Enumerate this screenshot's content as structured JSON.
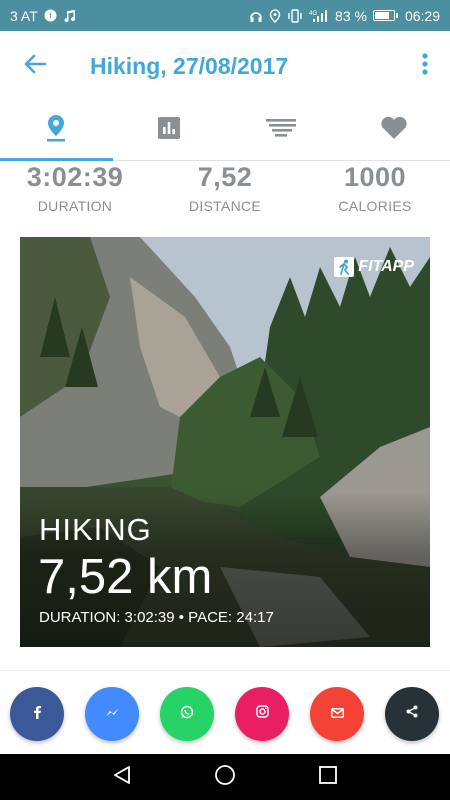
{
  "status_bar": {
    "carrier": "3 AT",
    "battery": "83 %",
    "battery_level": 0.83,
    "time": "06:29",
    "icons": [
      "carrier-badge-icon",
      "music-note-icon",
      "headphones-icon",
      "location-icon",
      "vibrate-icon",
      "signal-icon",
      "battery-icon"
    ]
  },
  "app_bar": {
    "title": "Hiking, 27/08/2017",
    "back_icon": "arrow-back-icon",
    "more_icon": "more-vert-icon",
    "accent_color": "#43a7d7"
  },
  "tabs": [
    {
      "icon": "location-pin-icon",
      "active": true
    },
    {
      "icon": "bar-chart-icon",
      "active": false
    },
    {
      "icon": "notes-lines-icon",
      "active": false
    },
    {
      "icon": "heart-icon",
      "active": false
    }
  ],
  "stats": [
    {
      "value": "3:02:39",
      "label": "DURATION"
    },
    {
      "value": "7,52",
      "label": "DISTANCE"
    },
    {
      "value": "1000",
      "label": "CALORIES"
    }
  ],
  "photo_card": {
    "brand": "FITAPP",
    "activity": "HIKING",
    "distance": "7,52 km",
    "meta": "DURATION: 3:02:39 • PACE: 24:17"
  },
  "share": [
    {
      "name": "facebook",
      "icon": "facebook-icon",
      "color": "#3b5998"
    },
    {
      "name": "messenger",
      "icon": "messenger-icon",
      "color": "#448aff"
    },
    {
      "name": "whatsapp",
      "icon": "whatsapp-icon",
      "color": "#25d366"
    },
    {
      "name": "instagram",
      "icon": "instagram-icon",
      "color": "#e91e63"
    },
    {
      "name": "email",
      "icon": "email-icon",
      "color": "#f44336"
    },
    {
      "name": "more-share",
      "icon": "share-icon",
      "color": "#263238"
    }
  ],
  "nav": [
    "back-triangle-icon",
    "home-circle-icon",
    "recents-square-icon"
  ]
}
